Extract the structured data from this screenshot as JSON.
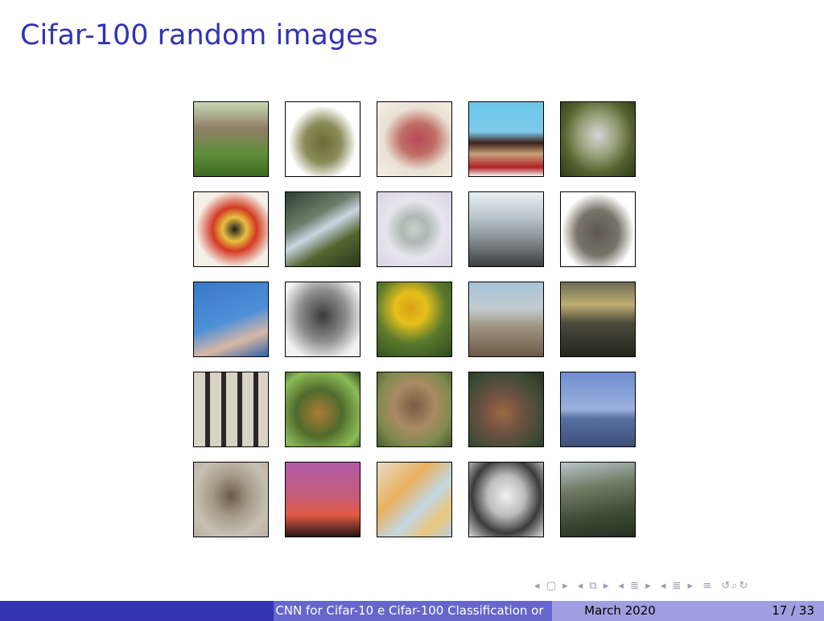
{
  "slide": {
    "title": "Cifar-100 random images"
  },
  "gallery": {
    "images": [
      {
        "name": "thumb-1"
      },
      {
        "name": "thumb-2"
      },
      {
        "name": "thumb-3"
      },
      {
        "name": "thumb-4"
      },
      {
        "name": "thumb-5"
      },
      {
        "name": "thumb-6"
      },
      {
        "name": "thumb-7"
      },
      {
        "name": "thumb-8"
      },
      {
        "name": "thumb-9"
      },
      {
        "name": "thumb-10"
      },
      {
        "name": "thumb-11"
      },
      {
        "name": "thumb-12"
      },
      {
        "name": "thumb-13"
      },
      {
        "name": "thumb-14"
      },
      {
        "name": "thumb-15"
      },
      {
        "name": "thumb-16"
      },
      {
        "name": "thumb-17"
      },
      {
        "name": "thumb-18"
      },
      {
        "name": "thumb-19"
      },
      {
        "name": "thumb-20"
      },
      {
        "name": "thumb-21"
      },
      {
        "name": "thumb-22"
      },
      {
        "name": "thumb-23"
      },
      {
        "name": "thumb-24"
      },
      {
        "name": "thumb-25"
      }
    ]
  },
  "footer": {
    "talk_title": "CNN for Cifar-10 e Cifar-100 Classification or",
    "date": "March 2020",
    "page": "17 / 33"
  },
  "navigation": {
    "icons": [
      "nav-prev-frame-icon",
      "nav-next-frame-icon",
      "nav-prev-subsection-icon",
      "nav-next-subsection-icon",
      "nav-prev-section-icon",
      "nav-next-section-icon",
      "nav-align-icon",
      "nav-search-icon"
    ]
  },
  "colors": {
    "title": "#3333b3",
    "footer_dark": "#3333b3",
    "footer_mid": "#6666cc",
    "footer_light": "#9f9fe0"
  }
}
